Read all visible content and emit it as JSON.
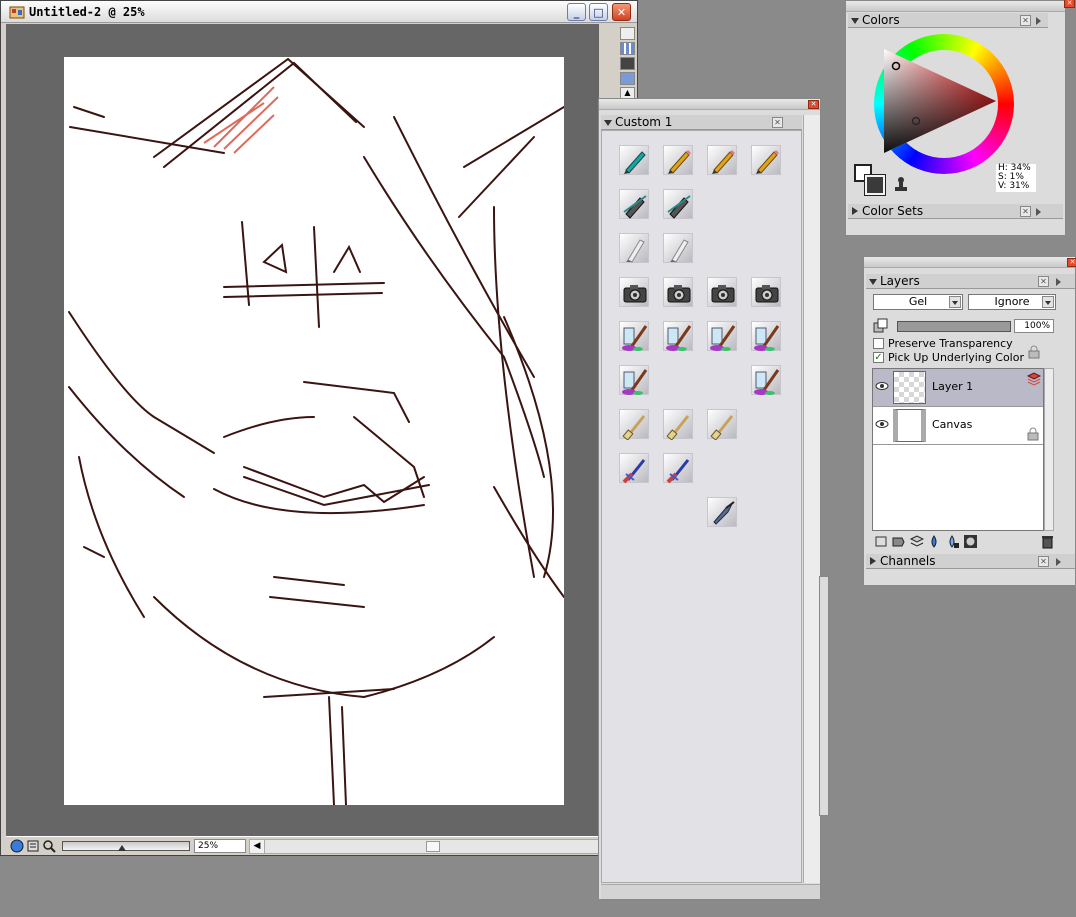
{
  "document": {
    "title": "Untitled-2 @ 25%",
    "zoom_value": "25%",
    "zoom_level": 0.25
  },
  "colors_palette": {
    "title": "Colors",
    "hsv": {
      "h": "H: 34%",
      "s": "S: 1%",
      "v": "V: 31%"
    },
    "foreground_color": "#ffffff",
    "background_color": "#3a3a3a",
    "color_sets_label": "Color Sets"
  },
  "custom_palette": {
    "title": "Custom  1",
    "brush_icons": [
      "pencil-teal-icon",
      "pencil-gold-icon",
      "pencil-gold-icon",
      "pencil-gold-icon",
      "eraser-pen-icon",
      "eraser-pen-icon",
      "nib-icon",
      "nib-icon",
      "camera-icon",
      "camera-icon",
      "camera-icon",
      "camera-icon",
      "water-brush-icon",
      "water-brush-icon",
      "water-brush-icon",
      "water-brush-icon",
      "water-brush-icon",
      "water-brush-icon",
      "flat-brush-icon",
      "flat-brush-icon",
      "flat-brush-icon",
      "color-brush-icon",
      "color-brush-icon",
      "palette-knife-icon"
    ]
  },
  "layers_palette": {
    "title": "Layers",
    "composite_method": "Gel",
    "depth": "Ignore",
    "opacity_value": "100%",
    "opacity_level": 1.0,
    "preserve_transparency": {
      "label": "Preserve Transparency",
      "checked": false
    },
    "pick_up_underlying": {
      "label": "Pick Up Underlying Color",
      "checked": true
    },
    "layers": [
      {
        "name": "Layer 1",
        "selected": true
      },
      {
        "name": "Canvas",
        "selected": false
      }
    ],
    "channels_label": "Channels"
  },
  "sketch_stroke_color": "#3a1410",
  "sketch_accent_color": "#e06a5a"
}
